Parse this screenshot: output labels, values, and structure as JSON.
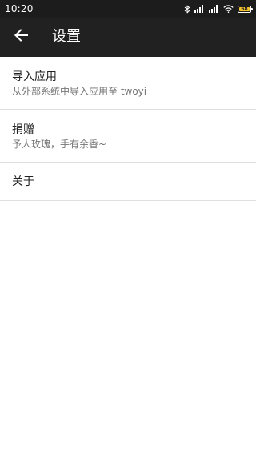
{
  "status_bar": {
    "time": "10:20",
    "battery_level": "68",
    "icons": [
      "bluetooth-icon",
      "signal-icon",
      "signal-icon",
      "wifi-icon",
      "battery-icon"
    ]
  },
  "app_bar": {
    "title": "设置",
    "back_icon": "arrow-back-icon"
  },
  "settings": {
    "items": [
      {
        "title": "导入应用",
        "subtitle": "从外部系统中导入应用至 twoyi"
      },
      {
        "title": "捐赠",
        "subtitle": "予人玫瑰，手有余香~"
      },
      {
        "title": "关于"
      }
    ]
  },
  "colors": {
    "status_bar_bg": "#1c1c1c",
    "app_bar_bg": "#212121",
    "title_text": "#212121",
    "subtitle_text": "#757575",
    "divider": "#e0e0e0",
    "battery_fill": "#f4c430"
  }
}
